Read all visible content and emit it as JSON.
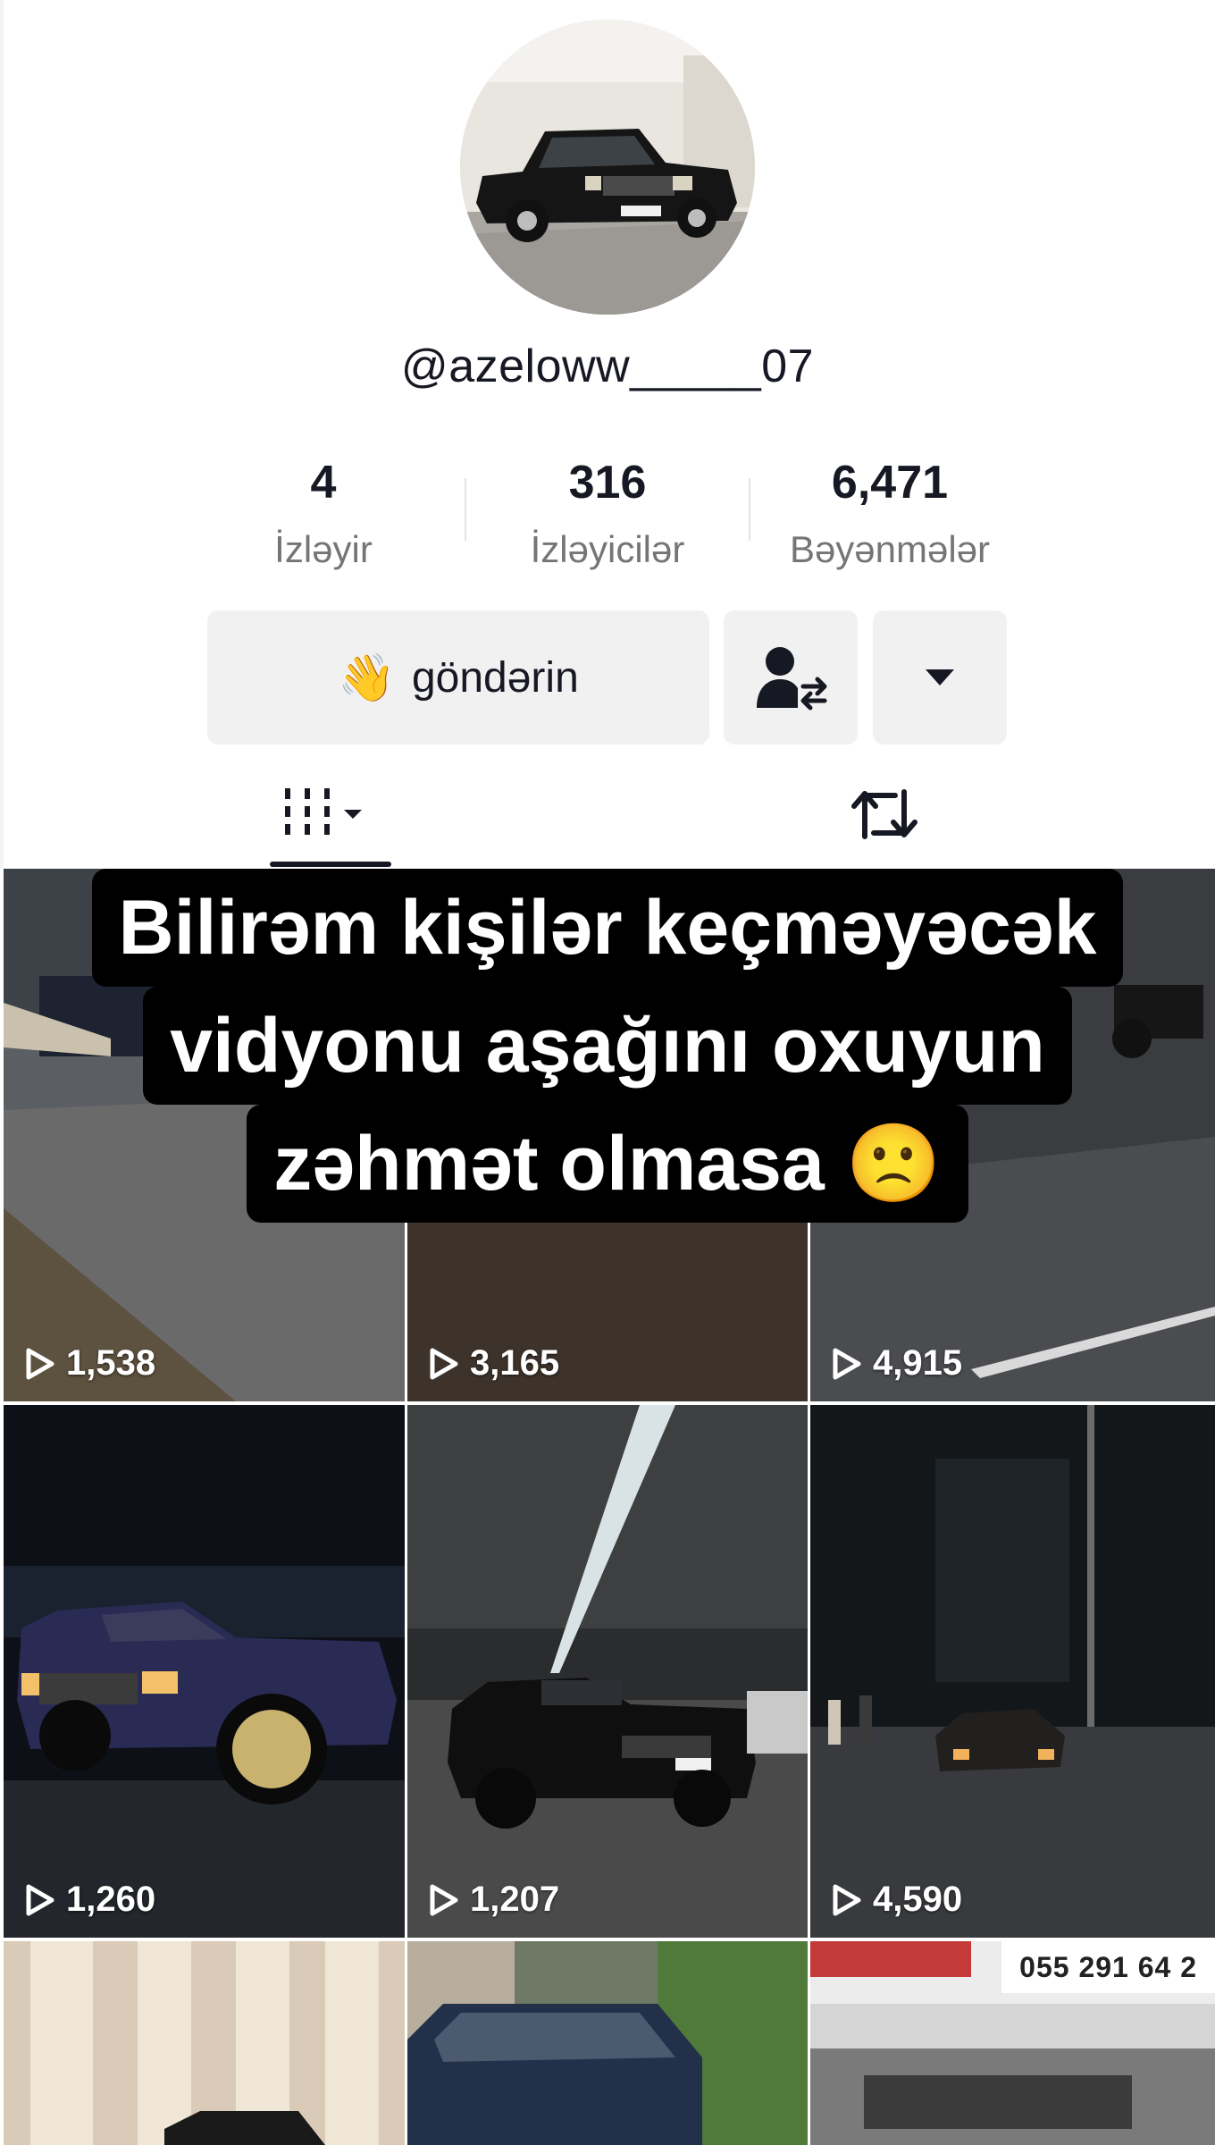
{
  "profile": {
    "username": "@azeloww_____07",
    "avatar_icon": "car-photo-avatar"
  },
  "stats": {
    "following": {
      "count": "4",
      "label": "İzləyir"
    },
    "followers": {
      "count": "316",
      "label": "İzləyicilər"
    },
    "likes": {
      "count": "6,471",
      "label": "Bəyənmələr"
    }
  },
  "actions": {
    "send_emoji": "👋",
    "send_label": "göndərin",
    "friend_icon": "add-friend-icon",
    "more_icon": "dropdown-triangle-icon"
  },
  "tabs": {
    "videos_icon": "video-grid-icon",
    "repost_icon": "repost-icon"
  },
  "caption": {
    "line1": "Bilirəm kişilər keçməyəcək",
    "line2": "vidyonu aşağını oxuyun",
    "line3": "zəhmət olmasa 🙁"
  },
  "videos": [
    {
      "views": "1,538"
    },
    {
      "views": "3,165"
    },
    {
      "views": "4,915"
    },
    {
      "views": "1,260"
    },
    {
      "views": "1,207"
    },
    {
      "views": "4,590"
    },
    {
      "views": ""
    },
    {
      "views": ""
    },
    {
      "views": "",
      "banner": "055 291 64 2"
    }
  ],
  "colors": {
    "text_primary": "#161823",
    "text_secondary": "#757575",
    "button_bg": "#f1f1f2"
  }
}
